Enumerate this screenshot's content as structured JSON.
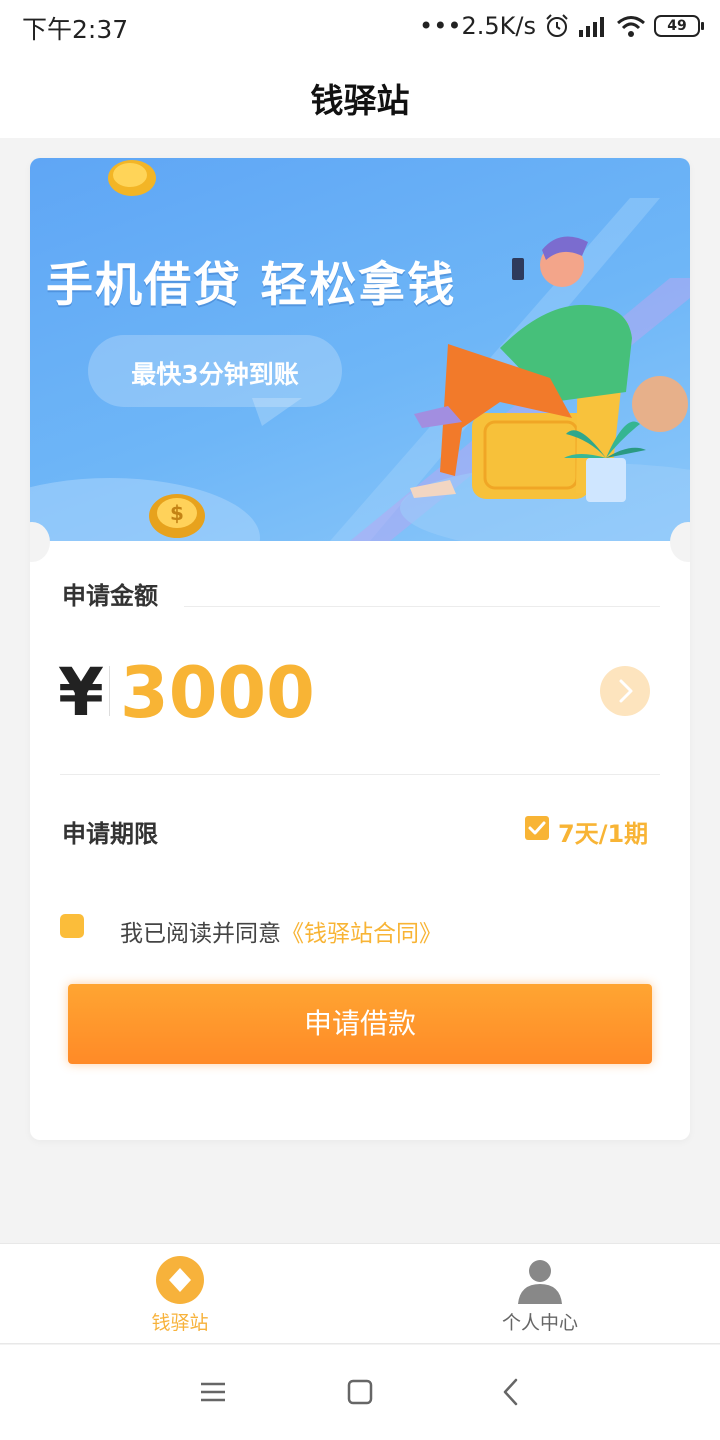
{
  "status_bar": {
    "time": "下午2:37",
    "net_speed": "•••2.5K/s",
    "battery": "49"
  },
  "header": {
    "title": "钱驿站"
  },
  "banner": {
    "headline": "手机借贷 轻松拿钱",
    "bubble": "最快3分钟到账"
  },
  "loan": {
    "amount_label": "申请金额",
    "currency": "¥",
    "amount": "3000",
    "period_label": "申请期限",
    "period_value": "7天/1期"
  },
  "agreement": {
    "prefix": "我已阅读并同意",
    "link": "《钱驿站合同》"
  },
  "apply_button": "申请借款",
  "tabbar": {
    "items": [
      {
        "label": "钱驿站",
        "icon": "diamond-icon",
        "active": true
      },
      {
        "label": "个人中心",
        "icon": "person-icon",
        "active": false
      }
    ]
  },
  "colors": {
    "accent": "#f8b435",
    "button_top": "#ffa532",
    "button_bottom": "#ff8a27",
    "banner": "#6eb6f7"
  }
}
